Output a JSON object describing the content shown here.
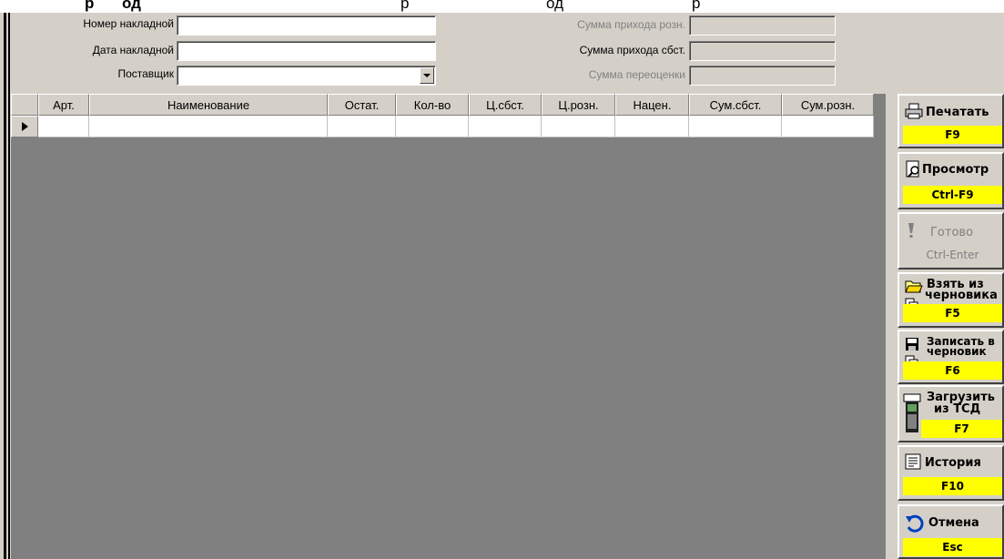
{
  "top_partial": [
    "р",
    "од",
    "р",
    "од",
    "р"
  ],
  "form": {
    "invoice_number_label": "Номер накладной",
    "invoice_number_value": "",
    "invoice_date_label": "Дата накладной",
    "invoice_date_value": "",
    "supplier_label": "Поставщик",
    "supplier_value": "",
    "sum_retail_label": "Сумма прихода розн.",
    "sum_cost_label": "Сумма прихода сбст.",
    "sum_reval_label": "Сумма переоценки"
  },
  "grid": {
    "columns": [
      "Арт.",
      "Наименование",
      "Остат.",
      "Кол-во",
      "Ц.сбст.",
      "Ц.розн.",
      "Нацен.",
      "Сум.сбст.",
      "Сум.розн."
    ],
    "rows": [
      [
        "",
        "",
        "",
        "",
        "",
        "",
        "",
        "",
        ""
      ]
    ]
  },
  "buttons": [
    {
      "label": "Печатать",
      "shortcut": "F9",
      "icon": "printer-icon"
    },
    {
      "label": "Просмотр",
      "shortcut": "Ctrl-F9",
      "icon": "preview-icon"
    },
    {
      "label": "Готово",
      "shortcut": "Ctrl-Enter",
      "icon": "exclamation-icon",
      "disabled": true
    },
    {
      "label1": "Взять из",
      "label2": "черновика",
      "shortcut": "F5",
      "icon": "open-folder-icon"
    },
    {
      "label1": "Записать в",
      "label2": "черновик",
      "shortcut": "F6",
      "icon": "floppy-disk-icon"
    },
    {
      "label1": "Загрузить",
      "label2": "из ТСД",
      "shortcut": "F7",
      "icon": "handheld-terminal-icon"
    },
    {
      "label": "История",
      "shortcut": "F10",
      "icon": "history-icon"
    },
    {
      "label": "Отмена",
      "shortcut": "Esc",
      "icon": "undo-arrow-icon"
    }
  ],
  "colors": {
    "face": "#d4d0c8",
    "shortcut_bg": "#ffff00",
    "grid_bg": "#808080"
  }
}
